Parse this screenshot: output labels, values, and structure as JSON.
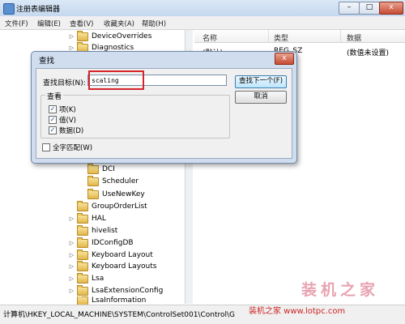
{
  "window": {
    "title": "注册表编辑器",
    "min": "–",
    "max": "□",
    "close": "x"
  },
  "menu": [
    "文件(F)",
    "编辑(E)",
    "查看(V)",
    "收藏夹(A)",
    "帮助(H)"
  ],
  "tree": {
    "items": [
      {
        "label": "DeviceOverrides",
        "depth": 0,
        "expand": "▷"
      },
      {
        "label": "Diagnostics",
        "depth": 0,
        "expand": "▷"
      },
      {
        "label": "DCI",
        "depth": 1,
        "expand": ""
      },
      {
        "label": "Scheduler",
        "depth": 1,
        "expand": ""
      },
      {
        "label": "UseNewKey",
        "depth": 1,
        "expand": ""
      },
      {
        "label": "GroupOrderList",
        "depth": 0,
        "expand": ""
      },
      {
        "label": "HAL",
        "depth": 0,
        "expand": "▷"
      },
      {
        "label": "hivelist",
        "depth": 0,
        "expand": ""
      },
      {
        "label": "IDConfigDB",
        "depth": 0,
        "expand": "▷"
      },
      {
        "label": "Keyboard Layout",
        "depth": 0,
        "expand": "▷"
      },
      {
        "label": "Keyboard Layouts",
        "depth": 0,
        "expand": "▷"
      },
      {
        "label": "Lsa",
        "depth": 0,
        "expand": "▷"
      },
      {
        "label": "LsaExtensionConfig",
        "depth": 0,
        "expand": "▷"
      },
      {
        "label": "LsaInformation",
        "depth": 0,
        "expand": ""
      }
    ]
  },
  "list": {
    "columns": [
      "名称",
      "类型",
      "数据"
    ],
    "rows": [
      {
        "name": "(默认)",
        "type": "REG_SZ",
        "data": "(数值未设置)"
      }
    ]
  },
  "status": {
    "path": "计算机\\HKEY_LOCAL_MACHINE\\SYSTEM\\ControlSet001\\Control\\G"
  },
  "dialog": {
    "title": "查找",
    "close": "x",
    "find_label": "查找目标(N):",
    "find_value": "scaling",
    "find_next": "查找下一个(F)",
    "cancel": "取消",
    "group_label": "查看",
    "cb_key": {
      "label": "项(K)",
      "checked": true
    },
    "cb_value": {
      "label": "值(V)",
      "checked": true
    },
    "cb_data": {
      "label": "数据(D)",
      "checked": true
    },
    "cb_whole": {
      "label": "全字匹配(W)",
      "checked": false
    },
    "check_mark": "✓"
  },
  "watermark": {
    "text": "装机之家",
    "url": "装机之家 www.lotpc.com"
  }
}
